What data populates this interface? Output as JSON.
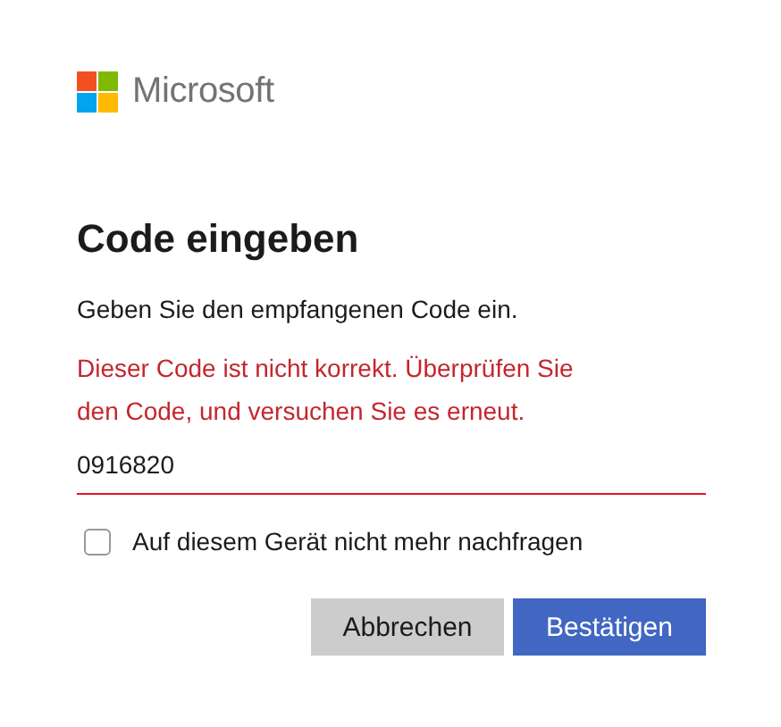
{
  "logo": {
    "text": "Microsoft"
  },
  "title": "Code eingeben",
  "description": "Geben Sie den empfangenen Code ein.",
  "error": "Dieser Code ist nicht korrekt. Überprüfen Sie den Code, und versuchen Sie es erneut.",
  "code_field": {
    "value": "0916820",
    "invalid": true
  },
  "remember_checkbox": {
    "label": "Auf diesem Gerät nicht mehr nachfragen",
    "checked": false
  },
  "buttons": [
    {
      "label": "Abbrechen",
      "kind": "secondary"
    },
    {
      "label": "Bestätigen",
      "kind": "primary"
    }
  ]
}
